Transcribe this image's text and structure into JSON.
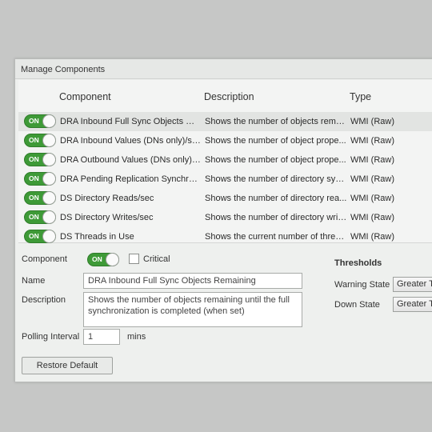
{
  "window": {
    "title": "Manage Components"
  },
  "table": {
    "headers": {
      "component": "Component",
      "description": "Description",
      "type": "Type"
    },
    "toggle_label": "ON",
    "rows": [
      {
        "component": "DRA Inbound Full Sync Objects Re...",
        "description": "Shows the number of objects rema...",
        "type": "WMI (Raw)",
        "selected": true
      },
      {
        "component": "DRA Inbound Values (DNs only)/sec",
        "description": "Shows the number of object prope...",
        "type": "WMI (Raw)"
      },
      {
        "component": "DRA Outbound Values (DNs only)/...",
        "description": "Shows the number of object prope...",
        "type": "WMI (Raw)"
      },
      {
        "component": "DRA Pending Replication Synchron...",
        "description": "Shows the number of directory syn...",
        "type": "WMI (Raw)"
      },
      {
        "component": "DS Directory Reads/sec",
        "description": "Shows the number of directory rea...",
        "type": "WMI (Raw)"
      },
      {
        "component": "DS Directory Writes/sec",
        "description": "Shows the number of directory writ...",
        "type": "WMI (Raw)"
      },
      {
        "component": "DS Threads in Use",
        "description": "Shows the current number of threa...",
        "type": "WMI (Raw)"
      }
    ]
  },
  "details": {
    "component_label": "Component",
    "toggle_label": "ON",
    "critical_label": "Critical",
    "name_label": "Name",
    "name_value": "DRA Inbound Full Sync Objects Remaining",
    "description_label": "Description",
    "description_value": "Shows the number of objects remaining until the full synchronization is completed (when set)",
    "polling_label": "Polling Interval",
    "polling_value": "1",
    "polling_unit": "mins",
    "restore_label": "Restore Default"
  },
  "thresholds": {
    "title": "Thresholds",
    "warning_label": "Warning State",
    "warning_value": "Greater Th",
    "down_label": "Down State",
    "down_value": "Greater Th"
  }
}
